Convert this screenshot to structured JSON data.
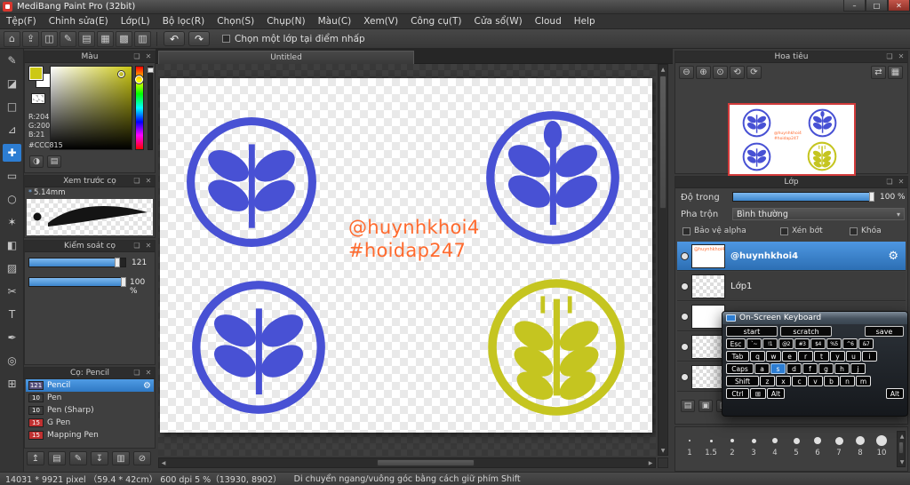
{
  "window": {
    "title": "MediBang Paint Pro (32bit)"
  },
  "menubar": {
    "items": [
      "Tệp(F)",
      "Chỉnh sửa(E)",
      "Lớp(L)",
      "Bộ lọc(R)",
      "Chọn(S)",
      "Chụp(N)",
      "Màu(C)",
      "Xem(V)",
      "Công cụ(T)",
      "Cửa sổ(W)",
      "Cloud",
      "Help"
    ]
  },
  "toolbar": {
    "select_layer_checkbox": "Chọn một lớp tại điểm nhấp"
  },
  "colors": {
    "accent_blue": "#2d7dd2",
    "logo_blue": "#4851d4",
    "logo_yellow": "#c5c520",
    "watermark_orange": "#ff6a2e",
    "foreground_swatch": "#ccc815",
    "navigator_border_red": "#d23b3b"
  },
  "color_panel": {
    "title": "Màu",
    "r": "R:204",
    "g": "G:200",
    "b": "B:21",
    "hex": "#CCC815"
  },
  "brush_preview": {
    "title": "Xem trước cọ",
    "size": "5.14mm"
  },
  "brush_control": {
    "title": "Kiểm soát cọ",
    "size_value": "121",
    "opacity_value": "100 %"
  },
  "brush_list": {
    "title": "Cọ: Pencil",
    "items": [
      {
        "size": "121",
        "name": "Pencil"
      },
      {
        "size": "10",
        "name": "Pen"
      },
      {
        "size": "10",
        "name": "Pen (Sharp)"
      },
      {
        "size": "15",
        "name": "G Pen"
      },
      {
        "size": "15",
        "name": "Mapping Pen"
      }
    ]
  },
  "canvas": {
    "tab": "Untitled",
    "watermark": [
      "@huynhkhoi4",
      "#hoidap247"
    ]
  },
  "navigator": {
    "title": "Hoa tiêu"
  },
  "layers_panel": {
    "title": "Lớp",
    "opacity_label": "Độ trong",
    "opacity_value": "100 %",
    "blend_label": "Pha trộn",
    "blend_value": "Bình thường",
    "alpha_lock_label": "Bảo vệ alpha",
    "clipping_label": "Xén bớt",
    "lock_label": "Khóa",
    "layers": [
      {
        "name": "@huynhkhoi4"
      },
      {
        "name": "Lớp1"
      }
    ]
  },
  "size_palette": {
    "labels": [
      "1",
      "1.5",
      "2",
      "3",
      "4",
      "5",
      "6",
      "7",
      "8",
      "10"
    ]
  },
  "osk": {
    "title": "On-Screen Keyboard",
    "buttons": [
      "start",
      "scratch",
      "save"
    ],
    "row1": [
      "Esc",
      "`~",
      "!1",
      "@2",
      "#3",
      "$4",
      "%5",
      "^6",
      "&7"
    ],
    "row2": [
      "Tab",
      "q",
      "w",
      "e",
      "r",
      "t",
      "y",
      "u",
      "i"
    ],
    "row3": [
      "Caps",
      "a",
      "s",
      "d",
      "f",
      "g",
      "h",
      "j"
    ],
    "row4": [
      "Shift",
      "z",
      "x",
      "c",
      "v",
      "b",
      "n",
      "m"
    ],
    "row5": [
      "Ctrl",
      "⊞",
      "Alt",
      "Alt"
    ]
  },
  "statusbar": {
    "info": "14031 * 9921 pixel （59.4 * 42cm） 600 dpi  5 %（13930, 8902）",
    "hint": "Di chuyển ngang/vuông góc bằng cách giữ phím Shift"
  },
  "icons": {
    "minimize": "–",
    "maximize": "□",
    "close": "✕",
    "undo": "↶",
    "redo": "↷",
    "popout": "❏",
    "panel_close": "✕",
    "dropdown": "▾",
    "gear": "⚙",
    "asterisk": "*",
    "up": "▲",
    "down": "▼",
    "left": "◀",
    "right": "▶",
    "toolbar": [
      "⌂",
      "⇪",
      "◫",
      "✎",
      "▤",
      "▦",
      "▩",
      "▥"
    ],
    "tools": [
      "✎",
      "◪",
      "□",
      "⊿",
      "✚",
      "▭",
      "○",
      "✶",
      "◧",
      "▨",
      "✂",
      "T",
      "✒",
      "◎",
      "⊞"
    ],
    "nav": [
      "⊖",
      "⊕",
      "⊙",
      "⟲",
      "⟳",
      "⇄",
      "▦"
    ],
    "color_tools": [
      "◑",
      "▤"
    ],
    "layer_tools": [
      "▤",
      "▣",
      "▥"
    ],
    "brush_tools": [
      "↥",
      "▤",
      "✎",
      "↧",
      "▥",
      "⊘"
    ]
  }
}
